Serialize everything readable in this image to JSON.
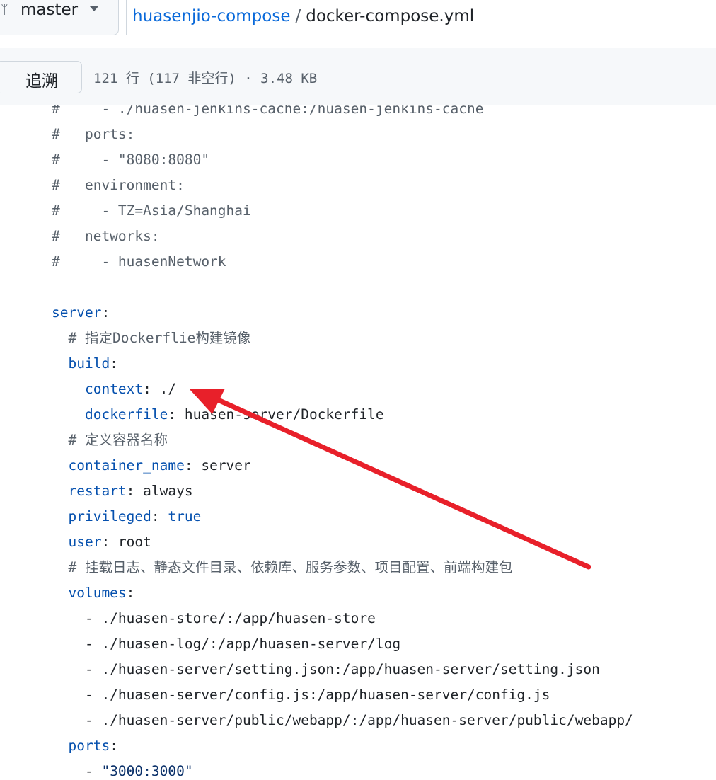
{
  "header": {
    "branch": "master",
    "repo": "huasenjio-compose",
    "separator": "/",
    "filename": "docker-compose.yml"
  },
  "toolbar": {
    "blame_label": "追溯",
    "file_info": "121 行 (117 非空行) · 3.48 KB"
  },
  "code": {
    "lines": [
      [
        {
          "t": "#     - ./huasen-jenkins-cache:/huasen-jenkins-cache",
          "c": "cm"
        }
      ],
      [
        {
          "t": "#   ports:",
          "c": "cm"
        }
      ],
      [
        {
          "t": "#     - \"8080:8080\"",
          "c": "cm"
        }
      ],
      [
        {
          "t": "#   environment:",
          "c": "cm"
        }
      ],
      [
        {
          "t": "#     - TZ=Asia/Shanghai",
          "c": "cm"
        }
      ],
      [
        {
          "t": "#   networks:",
          "c": "cm"
        }
      ],
      [
        {
          "t": "#     - huasenNetwork",
          "c": "cm"
        }
      ],
      [],
      [
        {
          "t": "server",
          "c": "k"
        },
        {
          "t": ":",
          "c": ""
        }
      ],
      [
        {
          "t": "  # 指定Dockerflie构建镜像",
          "c": "cm"
        }
      ],
      [
        {
          "t": "  ",
          "c": ""
        },
        {
          "t": "build",
          "c": "k"
        },
        {
          "t": ":",
          "c": ""
        }
      ],
      [
        {
          "t": "    ",
          "c": ""
        },
        {
          "t": "context",
          "c": "k"
        },
        {
          "t": ": ./",
          "c": ""
        }
      ],
      [
        {
          "t": "    ",
          "c": ""
        },
        {
          "t": "dockerfile",
          "c": "k"
        },
        {
          "t": ": huasen-server/Dockerfile",
          "c": ""
        }
      ],
      [
        {
          "t": "  # 定义容器名称",
          "c": "cm"
        }
      ],
      [
        {
          "t": "  ",
          "c": ""
        },
        {
          "t": "container_name",
          "c": "k"
        },
        {
          "t": ": server",
          "c": ""
        }
      ],
      [
        {
          "t": "  ",
          "c": ""
        },
        {
          "t": "restart",
          "c": "k"
        },
        {
          "t": ": always",
          "c": ""
        }
      ],
      [
        {
          "t": "  ",
          "c": ""
        },
        {
          "t": "privileged",
          "c": "k"
        },
        {
          "t": ": ",
          "c": ""
        },
        {
          "t": "true",
          "c": "k"
        }
      ],
      [
        {
          "t": "  ",
          "c": ""
        },
        {
          "t": "user",
          "c": "k"
        },
        {
          "t": ": root",
          "c": ""
        }
      ],
      [
        {
          "t": "  # 挂载日志、静态文件目录、依赖库、服务参数、项目配置、前端构建包",
          "c": "cm"
        }
      ],
      [
        {
          "t": "  ",
          "c": ""
        },
        {
          "t": "volumes",
          "c": "k"
        },
        {
          "t": ":",
          "c": ""
        }
      ],
      [
        {
          "t": "    - ./huasen-store/:/app/huasen-store",
          "c": ""
        }
      ],
      [
        {
          "t": "    - ./huasen-log/:/app/huasen-server/log",
          "c": ""
        }
      ],
      [
        {
          "t": "    - ./huasen-server/setting.json:/app/huasen-server/setting.json",
          "c": ""
        }
      ],
      [
        {
          "t": "    - ./huasen-server/config.js:/app/huasen-server/config.js",
          "c": ""
        }
      ],
      [
        {
          "t": "    - ./huasen-server/public/webapp/:/app/huasen-server/public/webapp/",
          "c": ""
        }
      ],
      [
        {
          "t": "  ",
          "c": ""
        },
        {
          "t": "ports",
          "c": "k"
        },
        {
          "t": ":",
          "c": ""
        }
      ],
      [
        {
          "t": "    - ",
          "c": ""
        },
        {
          "t": "\"3000:3000\"",
          "c": "s"
        }
      ]
    ]
  },
  "annotation": {
    "arrow_color": "#e8202a"
  }
}
